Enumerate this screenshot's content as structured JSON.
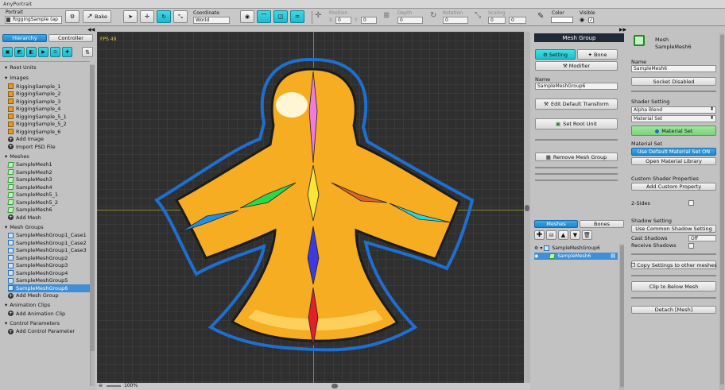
{
  "window": {
    "title": "AnyPortrait"
  },
  "toolbar": {
    "portrait_label": "Portrait",
    "portrait_value": "RiggingSample (ap",
    "bake_label": "Bake",
    "coordinate_label": "Coordinate",
    "coordinate_value": "World",
    "position_label": "Position",
    "pos_x_label": "X",
    "pos_x": "0",
    "pos_y_label": "Y",
    "pos_y": "0",
    "depth_label": "Depth",
    "depth": "0",
    "rotation_label": "Rotation",
    "rotation": "0",
    "scaling_label": "Scaling",
    "scale_x": "0",
    "scale_y": "0",
    "color_label": "Color",
    "visible_label": "Visible",
    "color_value": "#ffffff"
  },
  "hierarchy": {
    "tab_hierarchy": "Hierarchy",
    "tab_controller": "Controller",
    "root_units": "Root Units",
    "images_header": "Images",
    "images": [
      "RiggingSample_1",
      "RiggingSample_2",
      "RiggingSample_3",
      "RiggingSample_4",
      "RiggingSample_5_1",
      "RiggingSample_5_2",
      "RiggingSample_6"
    ],
    "add_image": "Add Image",
    "import_psd": "Import PSD File",
    "meshes_header": "Meshes",
    "meshes": [
      "SampleMesh1",
      "SampleMesh2",
      "SampleMesh3",
      "SampleMesh4",
      "SampleMesh5_1",
      "SampleMesh5_2",
      "SampleMesh6"
    ],
    "add_mesh": "Add Mesh",
    "groups_header": "Mesh Groups",
    "groups": [
      "SampleMeshGroup1_Case1",
      "SampleMeshGroup1_Case2",
      "SampleMeshGroup1_Case3",
      "SampleMeshGroup2",
      "SampleMeshGroup3",
      "SampleMeshGroup4",
      "SampleMeshGroup5",
      "SampleMeshGroup6"
    ],
    "add_group": "Add Mesh Group",
    "anim_header": "Animation Clips",
    "add_anim": "Add Animation Clip",
    "params_header": "Control Parameters",
    "add_param": "Add Control Parameter",
    "selected_color": "#3e8fd8"
  },
  "viewport": {
    "fps": "FPS 49",
    "zoom": "100%",
    "background": "#2f2f2f"
  },
  "meshgroup": {
    "header": "Mesh Group",
    "tab_setting": "Setting",
    "tab_bone": "Bone",
    "modifier": "Modifier",
    "name_label": "Name",
    "name_value": "SampleMeshGroup6",
    "edit_default": "Edit Default Transform",
    "set_root": "Set Root Unit",
    "remove": "Remove Mesh Group",
    "tab_meshes": "Meshes",
    "tab_bones": "Bones",
    "tree_group": "SampleMeshGroup6",
    "tree_mesh": "SampleMesh6"
  },
  "mesh_panel": {
    "type": "Mesh",
    "title": "SampleMesh6",
    "name_label": "Name",
    "name_value": "SampleMesh6",
    "socket": "Socket Disabled",
    "shader_label": "Shader Setting",
    "shader_value": "Alpha Blend",
    "material_set_value": "Material Set",
    "material_set_btn": "Material Set",
    "material_set_label": "Material Set",
    "use_default": "Use Default Material Set ON",
    "open_library": "Open Material Library",
    "custom_shader": "Custom Shader Properties",
    "add_custom": "Add Custom Property",
    "two_sides": "2-Sides",
    "shadow_label": "Shadow Setting",
    "common_shadow": "Use Common Shadow Setting",
    "cast_label": "Cast Shadows",
    "cast_value": "Off",
    "receive_label": "Receive Shadows",
    "copy_settings": "Copy Settings to other meshes",
    "clip_below": "Clip to Below Mesh",
    "detach": "Detach [Mesh]"
  }
}
